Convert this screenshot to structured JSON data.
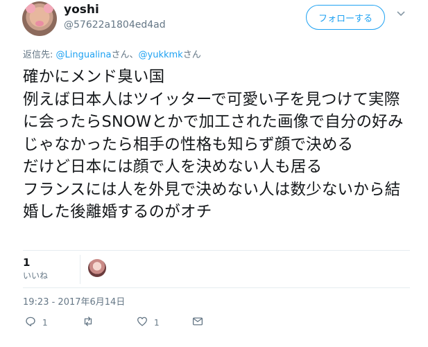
{
  "user": {
    "display_name": "yoshi",
    "handle": "@57622a1804ed4ad",
    "avatar_icon": "pig-mask-avatar-icon"
  },
  "follow_button": {
    "label": "フォローする"
  },
  "reply_to": {
    "prefix": "返信先: ",
    "user1": "@Lingualina",
    "sep": "さん、",
    "user2": "@yukkmk",
    "suffix": "さん"
  },
  "tweet": {
    "text": "確かにメンド臭い国\n例えば日本人はツイッターで可愛い子を見つけて実際に会ったらSNOWとかで加工された画像で自分の好みじゃなかったら相手の性格も知らず顔で決める\nだけど日本には顔で人を決めない人も居る\nフランスには人を外見で決めない人は数少ないから結婚した後離婚するのがオチ"
  },
  "stats": {
    "likes_count": "1",
    "likes_label": "いいね"
  },
  "timestamp": "19:23 - 2017年6月14日",
  "actions": {
    "reply_count": "1",
    "retweet_count": "",
    "like_count": "1"
  },
  "colors": {
    "accent": "#1da1f2",
    "muted": "#657786",
    "border": "#e6ecf0"
  }
}
